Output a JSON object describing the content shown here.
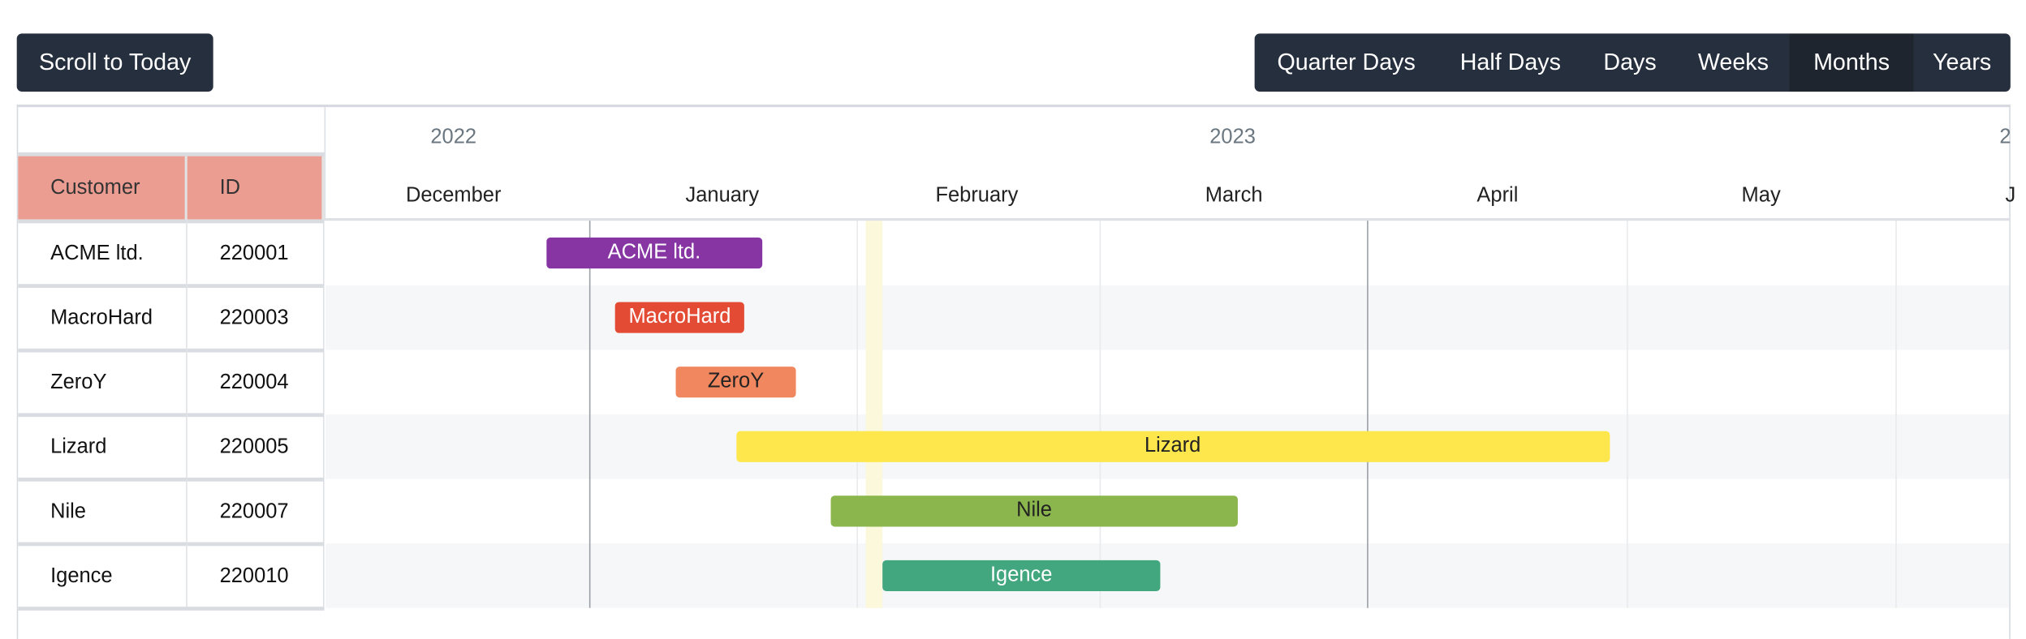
{
  "toolbar": {
    "scroll_to_today": "Scroll to Today",
    "view_modes": [
      {
        "label": "Quarter Days",
        "active": false
      },
      {
        "label": "Half Days",
        "active": false
      },
      {
        "label": "Days",
        "active": false
      },
      {
        "label": "Weeks",
        "active": false
      },
      {
        "label": "Months",
        "active": true
      },
      {
        "label": "Years",
        "active": false
      }
    ]
  },
  "table": {
    "columns": [
      "Customer",
      "ID"
    ],
    "rows": [
      {
        "customer": "ACME ltd.",
        "id": "220001"
      },
      {
        "customer": "MacroHard",
        "id": "220003"
      },
      {
        "customer": "ZeroY",
        "id": "220004"
      },
      {
        "customer": "Lizard",
        "id": "220005"
      },
      {
        "customer": "Nile",
        "id": "220007"
      },
      {
        "customer": "Igence",
        "id": "220010"
      }
    ]
  },
  "timeline": {
    "years": [
      "2022",
      "2023",
      "2"
    ],
    "months": [
      "December",
      "January",
      "February",
      "March",
      "April",
      "May",
      "J"
    ],
    "today": "2023-02-02",
    "colors": {
      "header": "#ec9d92",
      "button": "#252f3d",
      "today_band": "#fbf8dc",
      "row_alt": "#f6f7f9"
    }
  },
  "bars": [
    {
      "label": "ACME ltd.",
      "start": "2022-12-27",
      "end": "2023-01-21",
      "color": "#8635a3",
      "text_color": "#ffffff"
    },
    {
      "label": "MacroHard",
      "start": "2023-01-04",
      "end": "2023-01-19",
      "color": "#e34b35",
      "text_color": "#ffffff"
    },
    {
      "label": "ZeroY",
      "start": "2023-01-11",
      "end": "2023-01-25",
      "color": "#f0875f",
      "text_color": "#222222"
    },
    {
      "label": "Lizard",
      "start": "2023-01-18",
      "end": "2023-04-29",
      "color": "#fde74c",
      "text_color": "#222222"
    },
    {
      "label": "Nile",
      "start": "2023-01-29",
      "end": "2023-03-17",
      "color": "#8bb64d",
      "text_color": "#222222"
    },
    {
      "label": "Igence",
      "start": "2023-02-04",
      "end": "2023-03-08",
      "color": "#42a67e",
      "text_color": "#ffffff"
    }
  ]
}
